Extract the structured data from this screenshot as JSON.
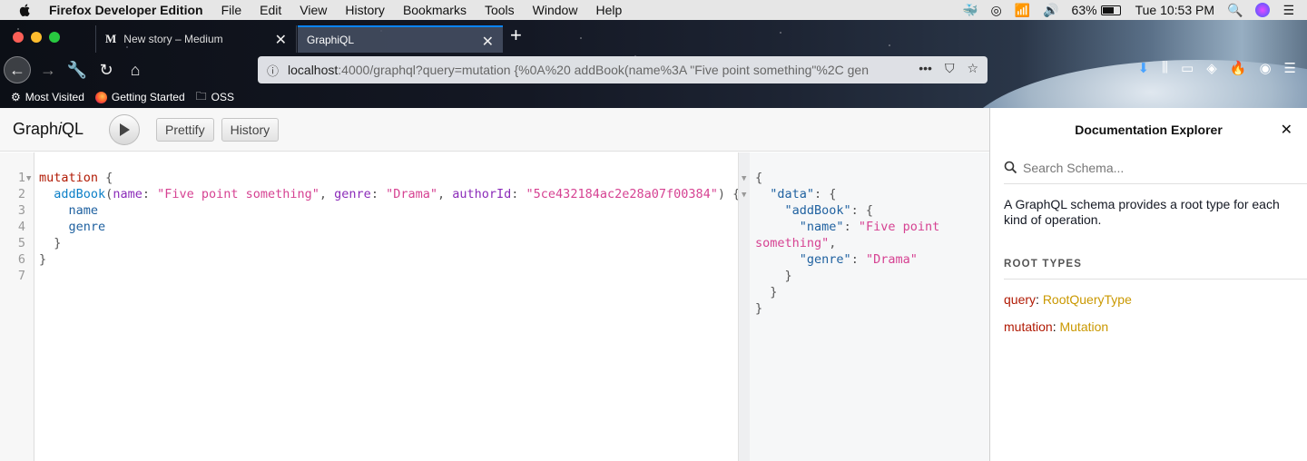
{
  "menubar": {
    "app": "Firefox Developer Edition",
    "items": [
      "File",
      "Edit",
      "View",
      "History",
      "Bookmarks",
      "Tools",
      "Window",
      "Help"
    ],
    "battery": "63%",
    "clock": "Tue 10:53 PM"
  },
  "tabs": [
    {
      "favicon": "M",
      "title": "New story – Medium"
    },
    {
      "title": "GraphiQL"
    }
  ],
  "urlbar": {
    "host": "localhost",
    "rest": ":4000/graphql?query=mutation {%0A%20 addBook(name%3A \"Five point something\"%2C gen"
  },
  "bookmarks": [
    "Most Visited",
    "Getting Started",
    "OSS"
  ],
  "graphiql": {
    "title_pre": "Graph",
    "title_i": "i",
    "title_post": "QL",
    "prettify": "Prettify",
    "history": "History"
  },
  "editor": {
    "line_numbers": [
      "1",
      "2",
      "3",
      "4",
      "5",
      "6",
      "7"
    ],
    "mutation_kw": "mutation",
    "open_brace": " {",
    "fn": "addBook",
    "arg_name": "name",
    "arg_name_val": "\"Five point something\"",
    "arg_genre": "genre",
    "arg_genre_val": "\"Drama\"",
    "arg_author": "authorId",
    "arg_author_val": "\"5ce432184ac2e28a07f00384\"",
    "field1": "name",
    "field2": "genre"
  },
  "result": {
    "data_key": "\"data\"",
    "addbook_key": "\"addBook\"",
    "name_key": "\"name\"",
    "name_val_a": "\"Five point",
    "name_val_b": "something\"",
    "genre_key": "\"genre\"",
    "genre_val": "\"Drama\""
  },
  "docs": {
    "title": "Documentation Explorer",
    "search_placeholder": "Search Schema...",
    "description": "A GraphQL schema provides a root type for each kind of operation.",
    "root_types_label": "ROOT TYPES",
    "root_types": [
      {
        "key": "query",
        "type": "RootQueryType"
      },
      {
        "key": "mutation",
        "type": "Mutation"
      }
    ]
  },
  "colors": {
    "keyword": "#b11a04",
    "string": "#d64292",
    "attribute": "#8b2bb9",
    "type": "#ca9800",
    "tab_accent": "#0a84ff"
  }
}
